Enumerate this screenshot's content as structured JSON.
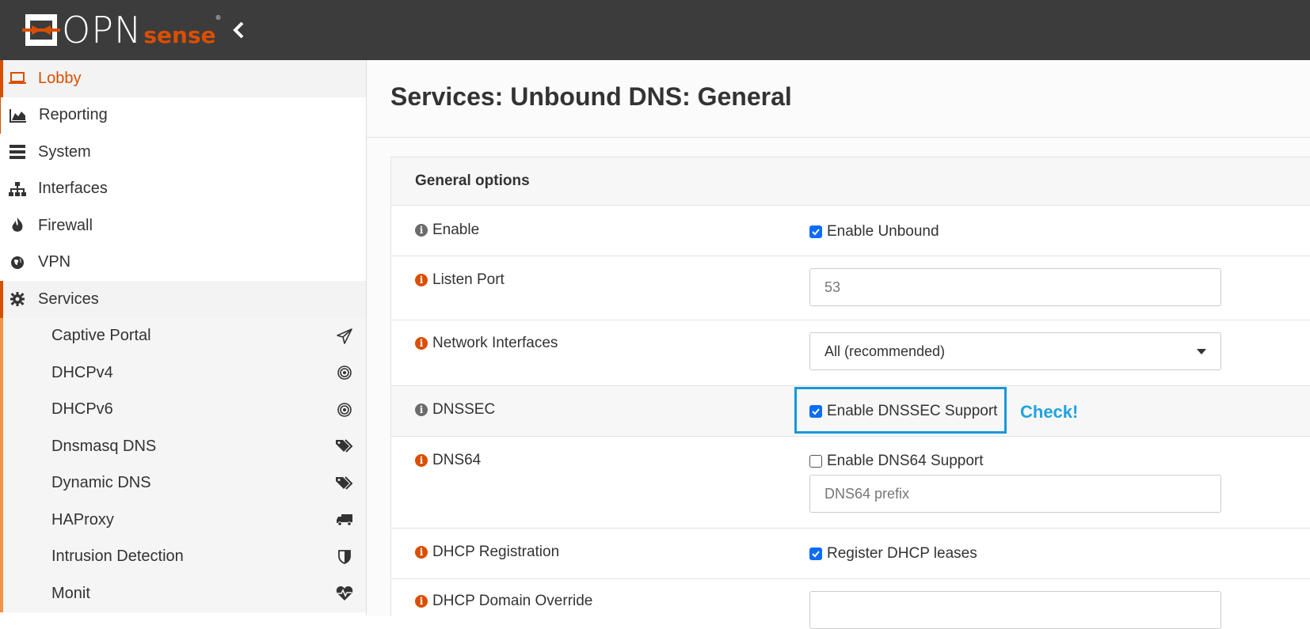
{
  "header": {
    "logo_primary": "OPN",
    "logo_secondary": "sense",
    "logo_reg": "®",
    "colors": {
      "bar": "#3c3c3c",
      "accent": "#d94f00"
    }
  },
  "sidebar": {
    "items": [
      {
        "label": "Lobby",
        "icon": "laptop-icon"
      },
      {
        "label": "Reporting",
        "icon": "area-chart-icon"
      },
      {
        "label": "System",
        "icon": "server-icon"
      },
      {
        "label": "Interfaces",
        "icon": "sitemap-icon"
      },
      {
        "label": "Firewall",
        "icon": "fire-icon"
      },
      {
        "label": "VPN",
        "icon": "globe-icon"
      },
      {
        "label": "Services",
        "icon": "gear-icon"
      }
    ],
    "services_sub": [
      {
        "label": "Captive Portal",
        "icon": "paper-plane-icon"
      },
      {
        "label": "DHCPv4",
        "icon": "bullseye-icon"
      },
      {
        "label": "DHCPv6",
        "icon": "bullseye-icon"
      },
      {
        "label": "Dnsmasq DNS",
        "icon": "tags-icon"
      },
      {
        "label": "Dynamic DNS",
        "icon": "tags-icon"
      },
      {
        "label": "HAProxy",
        "icon": "truck-icon"
      },
      {
        "label": "Intrusion Detection",
        "icon": "shield-icon"
      },
      {
        "label": "Monit",
        "icon": "heartbeat-icon"
      }
    ]
  },
  "main": {
    "title": "Services: Unbound DNS: General",
    "panel_title": "General options",
    "rows": {
      "enable": {
        "label": "Enable",
        "checkbox": "Enable Unbound",
        "checked": true
      },
      "listen_port": {
        "label": "Listen Port",
        "value": "53"
      },
      "network_interfaces": {
        "label": "Network Interfaces",
        "selected": "All (recommended)"
      },
      "dnssec": {
        "label": "DNSSEC",
        "checkbox": "Enable DNSSEC Support",
        "checked": true
      },
      "dns64": {
        "label": "DNS64",
        "checkbox": "Enable DNS64 Support",
        "checked": false,
        "prefix_placeholder": "DNS64 prefix"
      },
      "dhcp_registration": {
        "label": "DHCP Registration",
        "checkbox": "Register DHCP leases",
        "checked": true
      },
      "dhcp_domain_override": {
        "label": "DHCP Domain Override",
        "value": ""
      }
    }
  },
  "annotation": {
    "text": "Check!",
    "color": "#1fa2e0"
  }
}
